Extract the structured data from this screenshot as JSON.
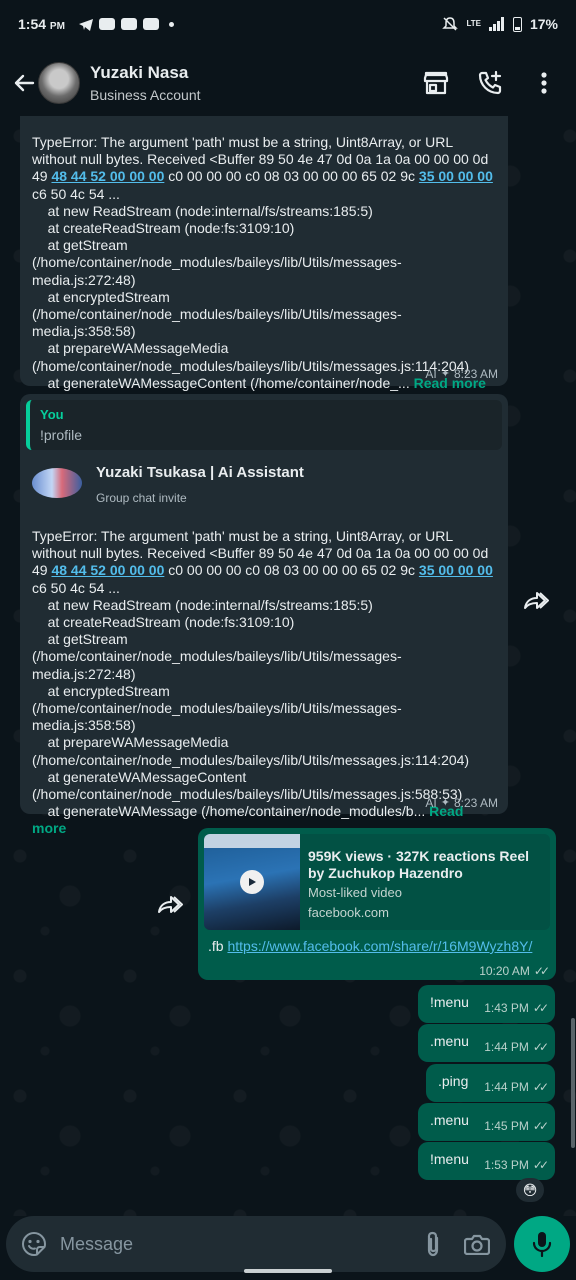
{
  "status_bar": {
    "time": "1:54",
    "ampm": "PM",
    "battery": "17%",
    "network": "LTE"
  },
  "header": {
    "name": "Yuzaki Nasa",
    "subtitle": "Business Account"
  },
  "messages": {
    "m1": {
      "text_a": "TypeError: The argument 'path' must be a string, Uint8Array, or URL without null bytes. Received <Buffer 89 50 4e 47 0d 0a 1a 0a 00 00 00 0d 49 ",
      "hl1": "48 44 52 00 00 00",
      "text_b": " c0 00 00 00 c0 08 03 00 00 00 65 02 9c ",
      "hl2": "35 00 00 00",
      "text_c": " c6 50 4c 54 ...\n    at new ReadStream (node:internal/fs/streams:185:5)\n    at createReadStream (node:fs:3109:10)\n    at getStream (/home/container/node_modules/baileys/lib/Utils/messages-media.js:272:48)\n    at encryptedStream (/home/container/node_modules/baileys/lib/Utils/messages-media.js:358:58)\n    at prepareWAMessageMedia (/home/container/node_modules/baileys/lib/Utils/messages.js:114:204)\n    at generateWAMessageContent (/home/container/node_...",
      "read_more": "Read more",
      "ai_label": "AI",
      "time": "8:23 AM"
    },
    "m2": {
      "quote_name": "You",
      "quote_text": "!profile",
      "invite_title": "Yuzaki Tsukasa | Ai Assistant",
      "invite_sub": "Group chat invite",
      "text_a": "TypeError: The argument 'path' must be a string, Uint8Array, or URL without null bytes. Received <Buffer 89 50 4e 47 0d 0a 1a 0a 00 00 00 0d 49 ",
      "hl1": "48 44 52 00 00 00",
      "text_b": " c0 00 00 00 c0 08 03 00 00 00 65 02 9c ",
      "hl2": "35 00 00 00",
      "text_c": " c6 50 4c 54 ...\n    at new ReadStream (node:internal/fs/streams:185:5)\n    at createReadStream (node:fs:3109:10)\n    at getStream (/home/container/node_modules/baileys/lib/Utils/messages-media.js:272:48)\n    at encryptedStream (/home/container/node_modules/baileys/lib/Utils/messages-media.js:358:58)\n    at prepareWAMessageMedia (/home/container/node_modules/baileys/lib/Utils/messages.js:114:204)\n    at generateWAMessageContent (/home/container/node_modules/baileys/lib/Utils/messages.js:588:53)\n    at generateWAMessage (/home/container/node_modules/b...",
      "read_more": "Read more",
      "ai_label": "AI",
      "time": "8:23 AM"
    },
    "m3": {
      "preview_title": "959K views · 327K reactions Reel by Zuchukop Hazendro",
      "preview_desc": "Most-liked video",
      "preview_domain": "facebook.com",
      "prefix": ".fb ",
      "link": "https://www.facebook.com/share/r/16M9Wyzh8Y/",
      "time": "10:20 AM"
    },
    "short": [
      {
        "text": "!menu",
        "time": "1:43 PM"
      },
      {
        "text": ".menu",
        "time": "1:44 PM"
      },
      {
        "text": ".ping",
        "time": "1:44 PM"
      },
      {
        "text": ".menu",
        "time": "1:45 PM"
      },
      {
        "text": "!menu",
        "time": "1:53 PM"
      }
    ],
    "reaction": "😳"
  },
  "input": {
    "placeholder": "Message"
  },
  "colors": {
    "accent": "#00a884",
    "incoming_bubble": "#202c33",
    "outgoing_bubble": "#005c4b",
    "link": "#53bdeb"
  }
}
